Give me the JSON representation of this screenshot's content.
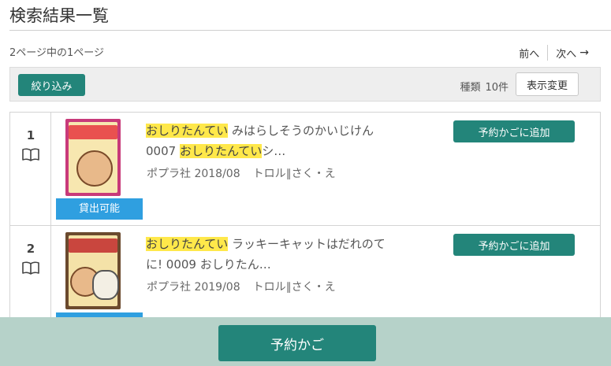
{
  "header": {
    "title": "検索結果一覧",
    "page_info": "2ページ中の1ページ",
    "prev_label": "前へ",
    "next_label": "次へ",
    "next_arrow": "→"
  },
  "filter_bar": {
    "filter_label": "絞り込み",
    "kind_label": "種類",
    "kind_count": "10件",
    "display_change_label": "表示変更"
  },
  "results": [
    {
      "number": "1",
      "title_highlight_1": "おしりたんてい",
      "title_part_1": " みはらしそうのかいじけん 0007 ",
      "title_highlight_2": "おしりたんてい",
      "title_part_2": "シ…",
      "publisher": "ポプラ社 2018/08",
      "author": "トロル∥さく・え",
      "status": "貸出可能",
      "add_label": "予約かごに追加"
    },
    {
      "number": "2",
      "title_highlight_1": "おしりたんてい",
      "title_part_1": " ラッキーキャットはだれのてに! 0009 おしりたん…",
      "publisher": "ポプラ社 2019/08",
      "author": "トロル∥さく・え",
      "add_label": "予約かごに追加"
    }
  ],
  "footer": {
    "cart_label": "予約かご"
  },
  "icons": {
    "book": "book-icon",
    "arrow": "arrow-right-icon"
  },
  "colors": {
    "accent": "#23857a",
    "highlight": "#ffe84a",
    "status_blue": "#2f9fe0",
    "footer_bg": "#b6d2c9"
  }
}
